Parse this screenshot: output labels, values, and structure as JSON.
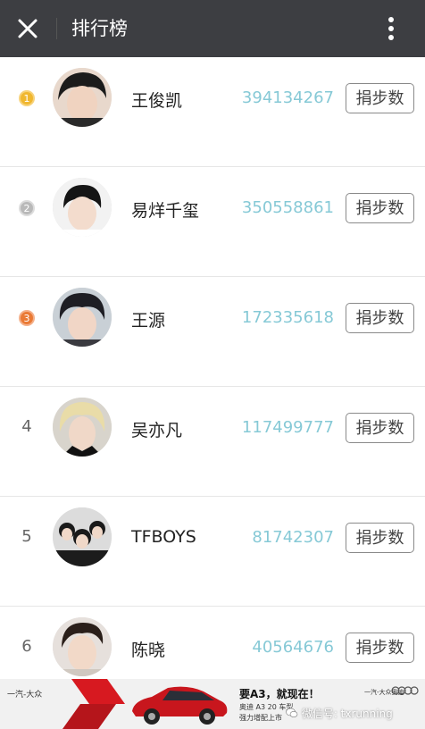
{
  "header": {
    "title": "排行榜",
    "close_icon": "close-icon",
    "more_icon": "more-vertical-icon",
    "background": "#3d3e42"
  },
  "rows": [
    {
      "rank": "1",
      "rank_style": "gold-medal",
      "name": "王俊凯",
      "steps": "394134267",
      "donate_label": "捐步数"
    },
    {
      "rank": "2",
      "rank_style": "silver-medal",
      "name": "易烊千玺",
      "steps": "350558861",
      "donate_label": "捐步数"
    },
    {
      "rank": "3",
      "rank_style": "bronze-medal",
      "name": "王源",
      "steps": "172335618",
      "donate_label": "捐步数"
    },
    {
      "rank": "4",
      "rank_style": "plain",
      "name": "吴亦凡",
      "steps": "117499777",
      "donate_label": "捐步数"
    },
    {
      "rank": "5",
      "rank_style": "plain",
      "name": "TFBOYS",
      "steps": "81742307",
      "donate_label": "捐步数"
    },
    {
      "rank": "6",
      "rank_style": "plain",
      "name": "陈晓",
      "steps": "40564676",
      "donate_label": "捐步数"
    }
  ],
  "colors": {
    "steps_text": "#86c9d6",
    "gold": "#f0b72f",
    "silver": "#b9b9b9",
    "bronze": "#ea7a35"
  },
  "ad": {
    "brand_left": "一汽-大众",
    "headline": "要A3，就现在！",
    "sub1": "奥迪 A3 20 车型",
    "sub2": "强力增配上市",
    "dealer": "一汽-大众奥迪",
    "watermark": "微信号: txrunning"
  }
}
